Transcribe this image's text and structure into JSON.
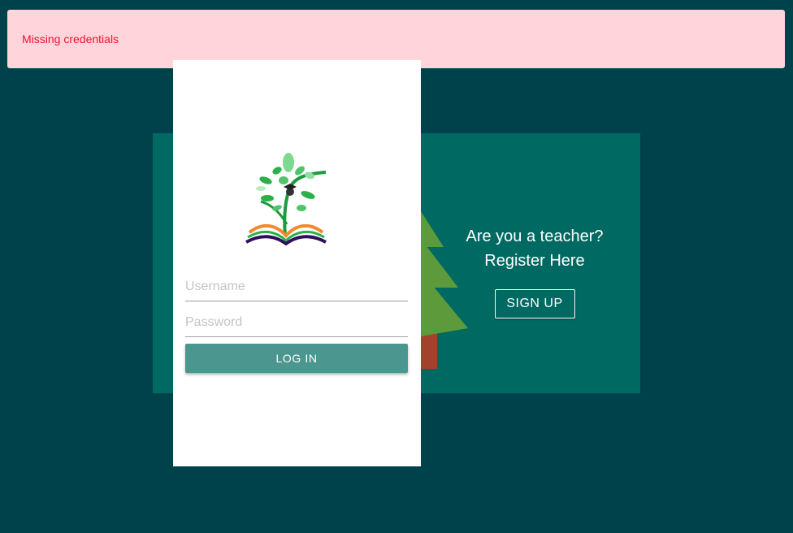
{
  "alert": {
    "message": "Missing credentials",
    "background": "#ffd5db",
    "text_color": "#e8142b"
  },
  "login": {
    "logo_icon": "tree-book-logo-icon",
    "username_placeholder": "Username",
    "password_placeholder": "Password",
    "login_label": "LOG IN",
    "button_color": "#4b968e"
  },
  "signup": {
    "question": "Are you a teacher?",
    "register": "Register Here",
    "signup_label": "SIGN UP",
    "panel_color": "#006962",
    "tree_icon": "pine-tree-icon"
  },
  "page": {
    "background": "#00424b"
  }
}
